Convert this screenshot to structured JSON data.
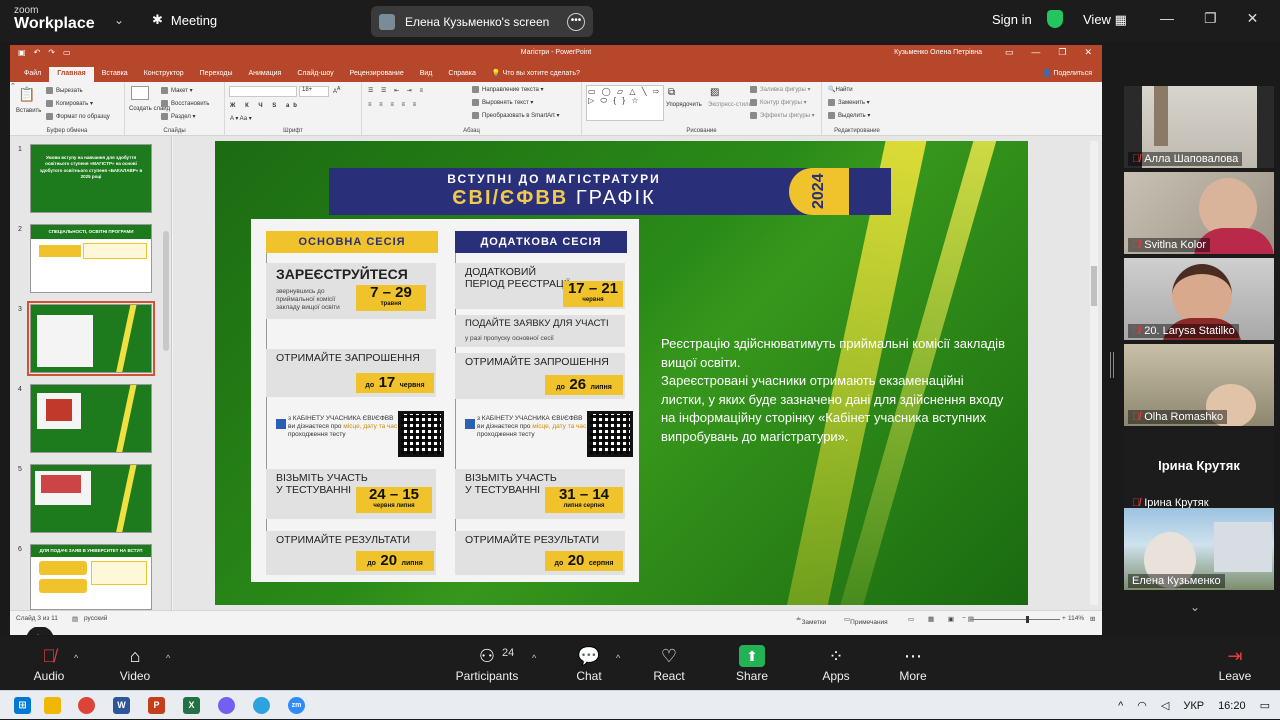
{
  "zoom_top": {
    "logo_line1": "zoom",
    "logo_line2": "Workplace",
    "meeting_label": "Meeting",
    "share_title": "Елена Кузьменко's screen",
    "signin_label": "Sign in",
    "view_label": "View"
  },
  "ppt": {
    "window_title": "Магістри - PowerPoint",
    "user_name": "Кузьменко Олена Петрівна",
    "tabs": [
      "Файл",
      "Главная",
      "Вставка",
      "Конструктор",
      "Переходы",
      "Анимация",
      "Слайд-шоу",
      "Рецензирование",
      "Вид",
      "Справка"
    ],
    "active_tab": "Главная",
    "tell_me": "Что вы хотите сделать?",
    "share_label": "Поделиться",
    "ribbon": {
      "clipboard": {
        "paste": "Вставить",
        "cut": "Вырезать",
        "copy": "Копировать",
        "format": "Формат по образцу",
        "label": "Буфер обмена"
      },
      "slides": {
        "new": "Создать слайд",
        "layout": "Макет",
        "reset": "Восстановить",
        "section": "Раздел",
        "label": "Слайды"
      },
      "font": {
        "size": "18+",
        "label": "Шрифт"
      },
      "paragraph": {
        "direction": "Направление текста",
        "align": "Выровнять текст",
        "smartart": "Преобразовать в SmartArt",
        "label": "Абзац"
      },
      "drawing": {
        "arrange": "Упорядочить",
        "styles": "Экспресс-стили",
        "fill": "Заливка фигуры",
        "outline": "Контур фигуры",
        "effects": "Эффекты фигуры",
        "label": "Рисование"
      },
      "editing": {
        "find": "Найти",
        "replace": "Заменить",
        "select": "Выделить",
        "label": "Редактирование"
      }
    },
    "thumbnails": [
      {
        "num": "1",
        "title": "Умови вступу на навчання для здобуття освітнього ступеня «МАГІСТР» на основі здобутого освітнього ступеня «БАКАЛАВР» в 2025 році"
      },
      {
        "num": "2",
        "title": "СПЕЦІАЛЬНОСТІ, ОСВІТНІ ПРОГРАМИ"
      },
      {
        "num": "3",
        "title": ""
      },
      {
        "num": "4",
        "title": ""
      },
      {
        "num": "5",
        "title": ""
      },
      {
        "num": "6",
        "title": "ДЛЯ ПОДАЧІ ЗАЯВ В УНІВЕРСИТЕТ НА ВСТУП"
      }
    ],
    "status": {
      "slide_counter": "Слайд 3 из 11",
      "language": "русский",
      "notes": "Заметки",
      "comments": "Примечания",
      "zoom": "114%"
    }
  },
  "slide": {
    "banner_line1": "ВСТУПНІ ДО МАГІСТРАТУРИ",
    "banner_line2_a": "ЄВІ/ЄФВВ",
    "banner_line2_b": "ГРАФІК",
    "banner_year": "2024",
    "main_session": {
      "header": "ОСНОВНА СЕСІЯ",
      "register": "ЗАРЕЄСТРУЙТЕСЯ",
      "register_note": "звернувшись до приймальної комісії закладу вищої освіти",
      "register_date": "7 – 29",
      "register_month": "травня",
      "invite": "ОТРИМАЙТЕ ЗАПРОШЕННЯ",
      "invite_prefix": "до",
      "invite_date": "17",
      "invite_month": "червня",
      "cabinet_note_a": "з КАБІНЕТУ УЧАСНИКА ЄВІ/ЄФВВ ви дізнаєтеся про",
      "cabinet_note_b": "місце, дату та час",
      "cabinet_note_c": "проходження тесту",
      "test": "ВІЗЬМІТЬ УЧАСТЬ У ТЕСТУВАННІ",
      "test_date": "24 – 15",
      "test_months": "червня   липня",
      "results": "ОТРИМАЙТЕ РЕЗУЛЬТАТИ",
      "results_prefix": "до",
      "results_date": "20",
      "results_month": "липня"
    },
    "extra_session": {
      "header": "ДОДАТКОВА СЕСІЯ",
      "register": "ДОДАТКОВИЙ ПЕРІОД РЕЄСТРАЦІЇ",
      "register_date": "17 – 21",
      "register_month": "червня",
      "apply": "ПОДАЙТЕ ЗАЯВКУ ДЛЯ УЧАСТІ",
      "apply_note": "у разі пропуску основної сесії",
      "invite": "ОТРИМАЙТЕ ЗАПРОШЕННЯ",
      "invite_prefix": "до",
      "invite_date": "26",
      "invite_month": "липня",
      "cabinet_note_a": "з КАБІНЕТУ УЧАСНИКА ЄВІ/ЄФВВ ви дізнаєтеся про",
      "cabinet_note_b": "місце, дату та час",
      "cabinet_note_c": "проходження тесту",
      "test": "ВІЗЬМІТЬ УЧАСТЬ У ТЕСТУВАННІ",
      "test_date": "31 – 14",
      "test_months": "липня   серпня",
      "results": "ОТРИМАЙТЕ РЕЗУЛЬТАТИ",
      "results_prefix": "до",
      "results_date": "20",
      "results_month": "серпня"
    },
    "text_p1": "Реєстрацію здійснюватимуть приймальні комісії закладів вищої освіти.",
    "text_p2": "Зареєстровані учасники отримають екзаменаційні листки, у яких буде зазначено дані для здійснення входу на інформаційну сторінку «Кабінет учасника вступних випробувань до магістратури»."
  },
  "participants": [
    {
      "name": "Алла Шаповалова",
      "muted": true
    },
    {
      "name": "Svitlna Kolor",
      "muted": true
    },
    {
      "name": "20. Larysa Statilko",
      "muted": true
    },
    {
      "name": "Olha Romashko",
      "muted": true
    },
    {
      "name": "Ірина Крутяк",
      "muted": true,
      "no_video": true
    },
    {
      "name": "Елена Кузьменко",
      "muted": false,
      "active": true
    }
  ],
  "zoom_bottom": {
    "audio": "Audio",
    "video": "Video",
    "participants": "Participants",
    "participants_count": "24",
    "chat": "Chat",
    "react": "React",
    "share": "Share",
    "apps": "Apps",
    "more": "More",
    "leave": "Leave"
  },
  "taskbar": {
    "lang": "УКР",
    "time": "16:20"
  },
  "colors": {
    "ppt_accent": "#b7472a",
    "slide_green": "#2a8a18",
    "banner_navy": "#2a2f7a",
    "date_yellow": "#f0c22b",
    "share_green": "#23b356"
  }
}
